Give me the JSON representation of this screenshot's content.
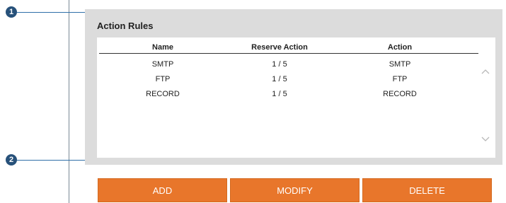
{
  "callouts": {
    "one": "1",
    "two": "2"
  },
  "panel": {
    "title": "Action Rules"
  },
  "table": {
    "columns": [
      "Name",
      "Reserve Action",
      "Action"
    ],
    "rows": [
      [
        "SMTP",
        "1 / 5",
        "SMTP"
      ],
      [
        "FTP",
        "1 / 5",
        "FTP"
      ],
      [
        "RECORD",
        "1 / 5",
        "RECORD"
      ]
    ]
  },
  "scroll": {
    "up_icon": "chevron-up",
    "down_icon": "chevron-down"
  },
  "buttons": {
    "add": "ADD",
    "modify": "MODIFY",
    "delete": "DELETE"
  },
  "colors": {
    "button": "#e8762b",
    "callout": "#27517a",
    "panel": "#dcdcdc"
  }
}
